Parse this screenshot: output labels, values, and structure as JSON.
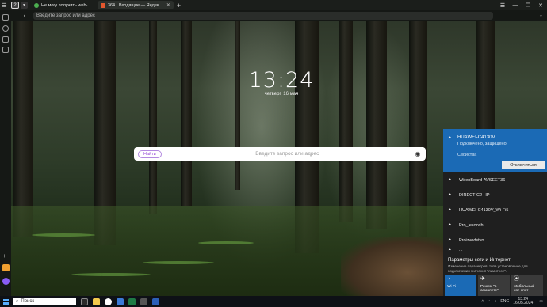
{
  "browser": {
    "tab_count": "2",
    "tabs": [
      {
        "title": "Не могу получить web-...",
        "favicon_color": "#4caf50",
        "active": false
      },
      {
        "title": "364 · Входящие — Яндек...",
        "favicon_color": "#e4572e",
        "active": true
      }
    ],
    "address_placeholder": "Введите запрос или адрес"
  },
  "newtab": {
    "time": "13:24",
    "date": "четверг, 16 мая",
    "search_badge": "Найти",
    "search_placeholder": "Введите запрос или адрес"
  },
  "wifi_panel": {
    "connected": {
      "name": "HUAWEI-C4130V",
      "status": "Подключено, защищено",
      "properties": "Свойства",
      "disconnect_button": "Отключиться"
    },
    "networks": [
      "WirenBoard-AVSEET36",
      "DIRECT-C2-HP",
      "HUAWEI-C4130V_Wi-Fi5",
      "Pro_lesoosh",
      "Proizvodstvo",
      "..."
    ],
    "settings_title": "Параметры сети и Интернет",
    "settings_desc": "Изменение параметров, типа установление для подключения значения \"лимитное\".",
    "quick_tiles": [
      {
        "label": "Wi-Fi",
        "active": true
      },
      {
        "label": "Режим \"в самолете\"",
        "active": false
      },
      {
        "label": "Мобильный хот-спот",
        "active": false
      }
    ]
  },
  "taskbar": {
    "search_placeholder": "Поиск",
    "lang": "ENG",
    "time": "13:24",
    "date": "16.05.2024"
  }
}
